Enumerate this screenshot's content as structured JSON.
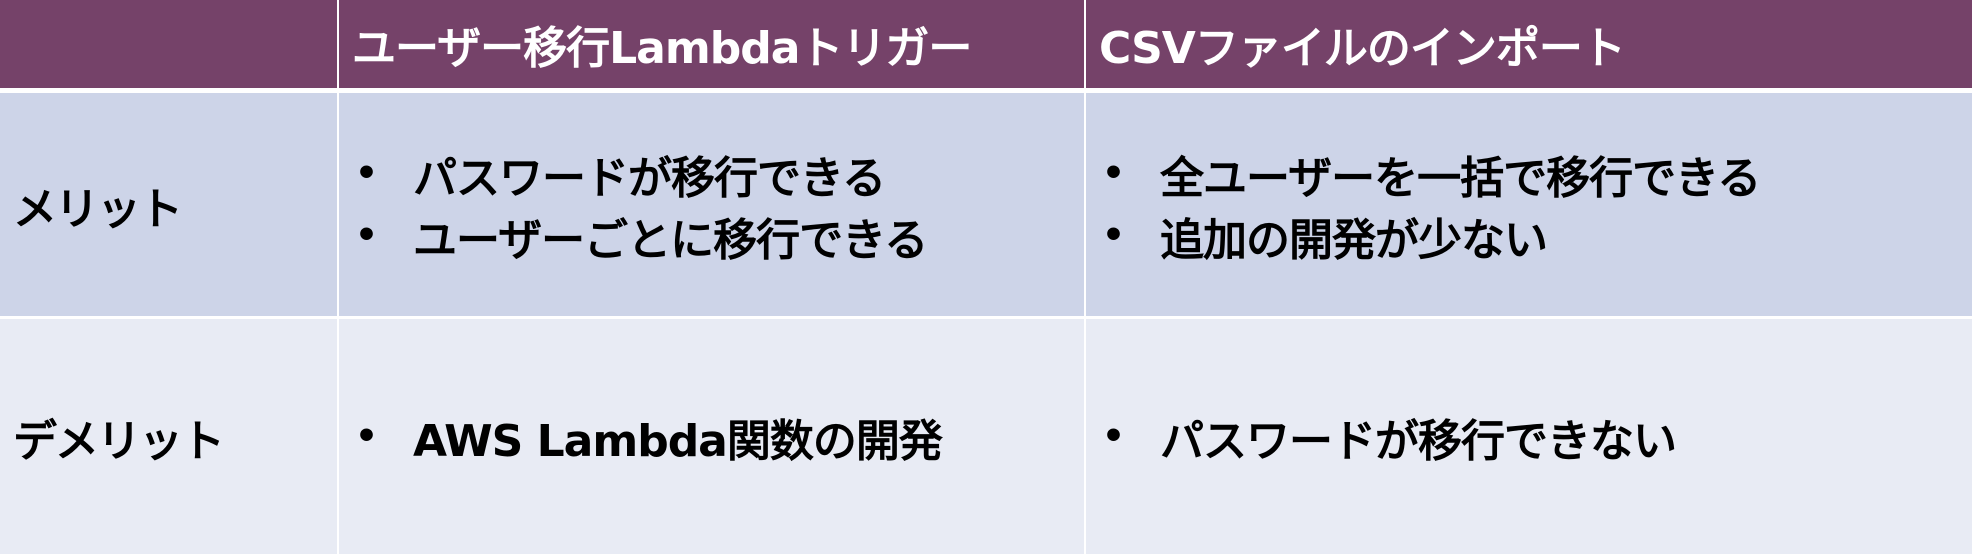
{
  "header": {
    "corner": "",
    "col1": "ユーザー移行Lambdaトリガー",
    "col2": "CSVファイルのインポート"
  },
  "rows": [
    {
      "label": "メリット",
      "col1": [
        "パスワードが移行できる",
        "ユーザーごとに移行できる"
      ],
      "col2": [
        "全ユーザーを一括で移行できる",
        "追加の開発が少ない"
      ]
    },
    {
      "label": "デメリット",
      "col1": [
        "AWS Lambda関数の開発"
      ],
      "col2": [
        "パスワードが移行できない"
      ]
    }
  ],
  "bullet_glyph": "•",
  "colors": {
    "header_bg": "#754269",
    "merit_bg": "#cdd4e8",
    "demerit_bg": "#e8ebf4"
  }
}
